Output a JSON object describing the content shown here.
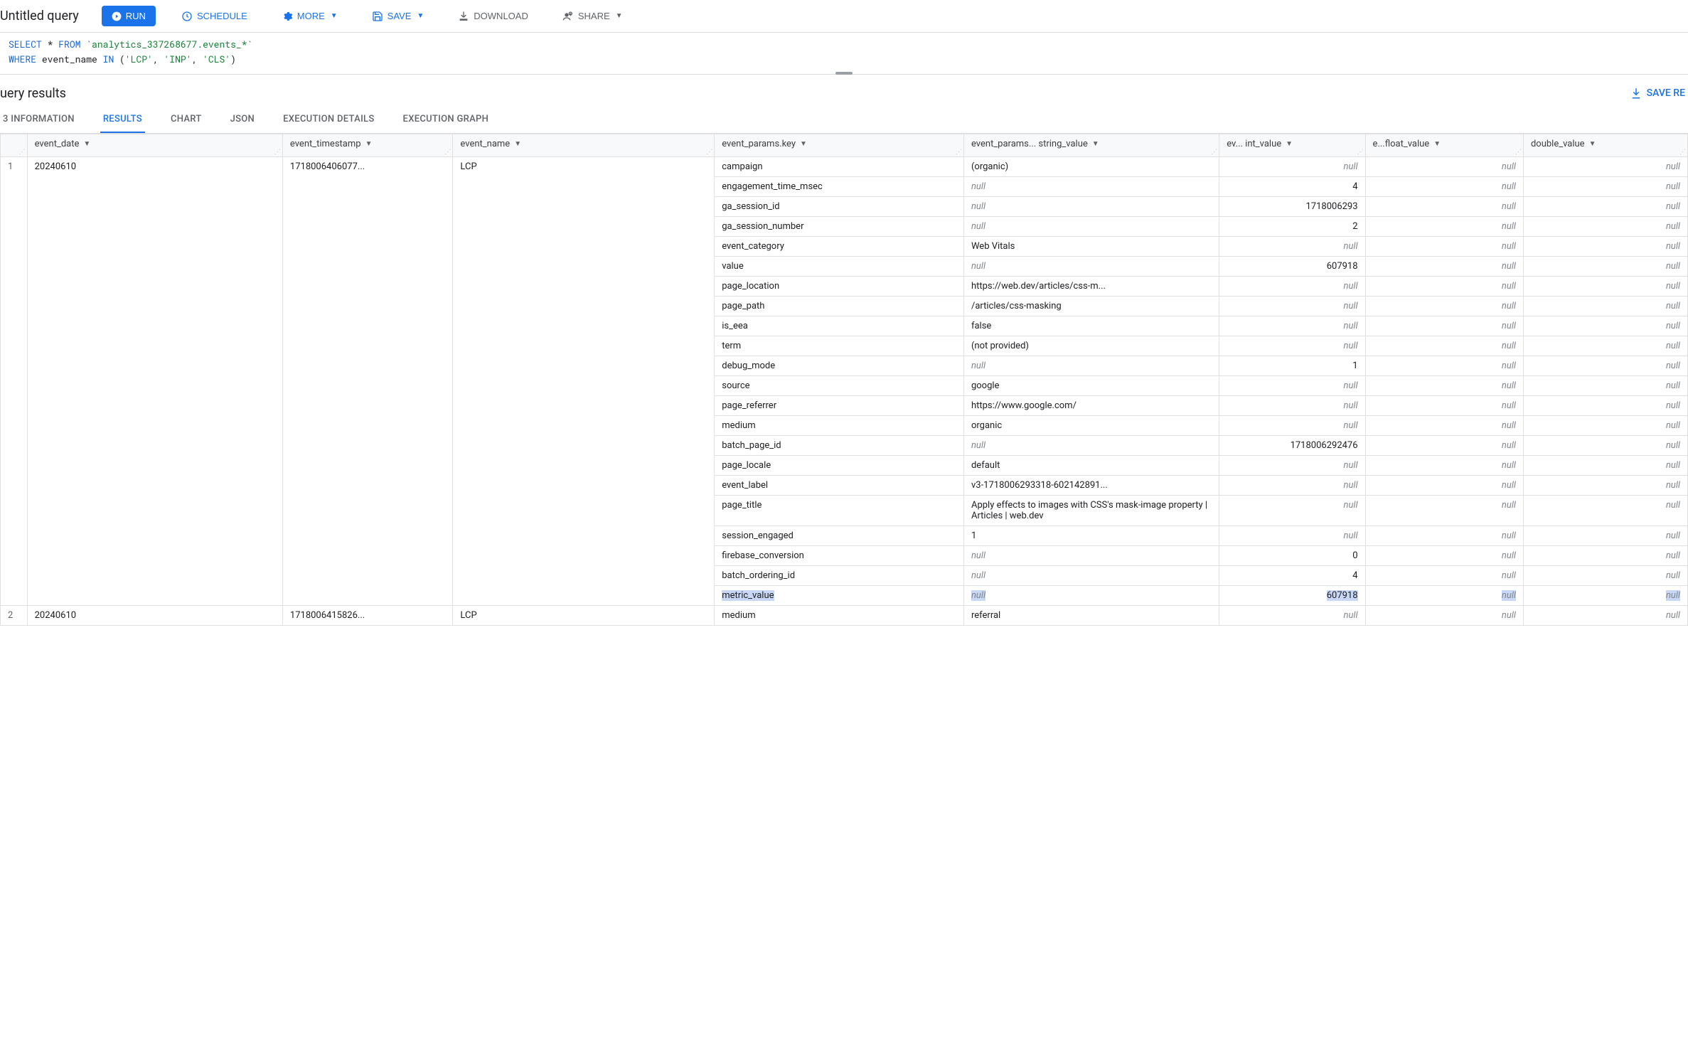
{
  "toolbar": {
    "title": "Untitled query",
    "run": "RUN",
    "schedule": "SCHEDULE",
    "more": "MORE",
    "save": "SAVE",
    "download": "DOWNLOAD",
    "share": "SHARE"
  },
  "editor": {
    "sql_tokens": [
      {
        "t": "SELECT",
        "c": "kw"
      },
      {
        "t": " * "
      },
      {
        "t": "FROM",
        "c": "kw"
      },
      {
        "t": " "
      },
      {
        "t": "`analytics_337268677.events_*`",
        "c": "tbl"
      },
      {
        "t": "\n"
      },
      {
        "t": "WHERE",
        "c": "kw"
      },
      {
        "t": " event_name "
      },
      {
        "t": "IN",
        "c": "kw"
      },
      {
        "t": " ("
      },
      {
        "t": "'LCP'",
        "c": "str"
      },
      {
        "t": ", "
      },
      {
        "t": "'INP'",
        "c": "str"
      },
      {
        "t": ", "
      },
      {
        "t": "'CLS'",
        "c": "str"
      },
      {
        "t": ")"
      }
    ]
  },
  "results": {
    "title": "uery results",
    "save_label": "SAVE RE",
    "tabs": [
      "3 INFORMATION",
      "RESULTS",
      "CHART",
      "JSON",
      "EXECUTION DETAILS",
      "EXECUTION GRAPH"
    ],
    "active_tab": 1,
    "columns": [
      "",
      "event_date",
      "event_timestamp",
      "event_name",
      "event_params.key",
      "event_params... string_value",
      "ev... int_value",
      "e...float_value",
      "double_value"
    ],
    "rows": [
      {
        "n": "1",
        "event_date": "20240610",
        "event_timestamp": "1718006406077...",
        "event_name": "LCP",
        "params": [
          {
            "key": "campaign",
            "string_value": "(organic)",
            "int_value": null,
            "float_value": null,
            "double_value": null
          },
          {
            "key": "engagement_time_msec",
            "string_value": null,
            "int_value": "4",
            "float_value": null,
            "double_value": null
          },
          {
            "key": "ga_session_id",
            "string_value": null,
            "int_value": "1718006293",
            "float_value": null,
            "double_value": null
          },
          {
            "key": "ga_session_number",
            "string_value": null,
            "int_value": "2",
            "float_value": null,
            "double_value": null
          },
          {
            "key": "event_category",
            "string_value": "Web Vitals",
            "int_value": null,
            "float_value": null,
            "double_value": null
          },
          {
            "key": "value",
            "string_value": null,
            "int_value": "607918",
            "float_value": null,
            "double_value": null
          },
          {
            "key": "page_location",
            "string_value": "https://web.dev/articles/css-m...",
            "int_value": null,
            "float_value": null,
            "double_value": null
          },
          {
            "key": "page_path",
            "string_value": "/articles/css-masking",
            "int_value": null,
            "float_value": null,
            "double_value": null
          },
          {
            "key": "is_eea",
            "string_value": "false",
            "int_value": null,
            "float_value": null,
            "double_value": null
          },
          {
            "key": "term",
            "string_value": "(not provided)",
            "int_value": null,
            "float_value": null,
            "double_value": null
          },
          {
            "key": "debug_mode",
            "string_value": null,
            "int_value": "1",
            "float_value": null,
            "double_value": null
          },
          {
            "key": "source",
            "string_value": "google",
            "int_value": null,
            "float_value": null,
            "double_value": null
          },
          {
            "key": "page_referrer",
            "string_value": "https://www.google.com/",
            "int_value": null,
            "float_value": null,
            "double_value": null
          },
          {
            "key": "medium",
            "string_value": "organic",
            "int_value": null,
            "float_value": null,
            "double_value": null
          },
          {
            "key": "batch_page_id",
            "string_value": null,
            "int_value": "1718006292476",
            "float_value": null,
            "double_value": null
          },
          {
            "key": "page_locale",
            "string_value": "default",
            "int_value": null,
            "float_value": null,
            "double_value": null
          },
          {
            "key": "event_label",
            "string_value": "v3-1718006293318-602142891...",
            "int_value": null,
            "float_value": null,
            "double_value": null
          },
          {
            "key": "page_title",
            "string_value": "Apply effects to images with CSS's mask-image property  |  Articles  |  web.dev",
            "int_value": null,
            "float_value": null,
            "double_value": null,
            "wrap": true
          },
          {
            "key": "session_engaged",
            "string_value": "1",
            "int_value": null,
            "float_value": null,
            "double_value": null
          },
          {
            "key": "firebase_conversion",
            "string_value": null,
            "int_value": "0",
            "float_value": null,
            "double_value": null
          },
          {
            "key": "batch_ordering_id",
            "string_value": null,
            "int_value": "4",
            "float_value": null,
            "double_value": null
          },
          {
            "key": "metric_value",
            "string_value": null,
            "int_value": "607918",
            "float_value": null,
            "double_value": null,
            "highlight": true
          }
        ]
      },
      {
        "n": "2",
        "event_date": "20240610",
        "event_timestamp": "1718006415826...",
        "event_name": "LCP",
        "params": [
          {
            "key": "medium",
            "string_value": "referral",
            "int_value": null,
            "float_value": null,
            "double_value": null
          }
        ]
      }
    ]
  }
}
